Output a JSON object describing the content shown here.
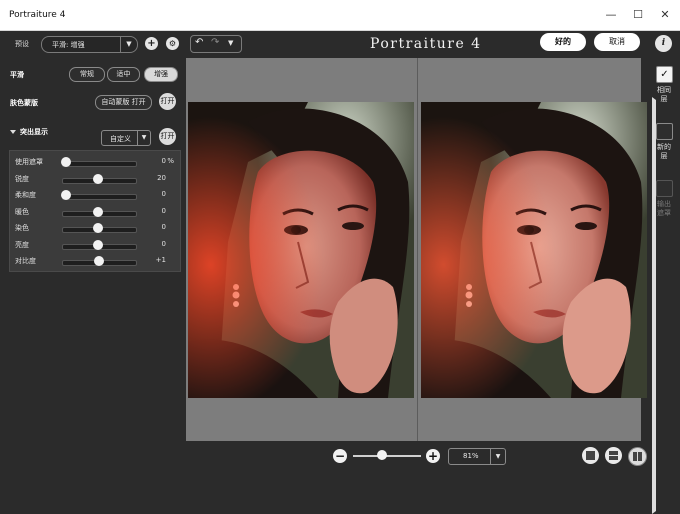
{
  "window": {
    "title": "Portraiture 4",
    "minimize": "—",
    "maximize": "☐",
    "close": "✕"
  },
  "topbar": {
    "preset_label": "预设",
    "preset_value": "平滑: 增强",
    "brand": "Portraiture 4",
    "ok_label": "好的",
    "cancel_label": "取消",
    "help": "i"
  },
  "panel": {
    "smoothing": {
      "title": "平滑",
      "options": [
        "常规",
        "适中",
        "增强"
      ],
      "active": 2
    },
    "skin_mask": {
      "title": "肤色蒙版",
      "auto_label": "自动蒙版 打开",
      "toggle": "打开"
    },
    "enhance": {
      "title": "突出显示",
      "mode": "自定义",
      "toggle": "打开"
    },
    "sliders": [
      {
        "name": "使用遮罩",
        "value": "0",
        "unit": "%",
        "level": 0.0
      },
      {
        "name": "锐度",
        "value": "20",
        "unit": "",
        "level": 0.5
      },
      {
        "name": "柔和度",
        "value": "0",
        "unit": "",
        "level": 0.0
      },
      {
        "name": "暖色",
        "value": "0",
        "unit": "",
        "level": 0.5
      },
      {
        "name": "染色",
        "value": "0",
        "unit": "",
        "level": 0.5
      },
      {
        "name": "亮度",
        "value": "0",
        "unit": "",
        "level": 0.5
      },
      {
        "name": "对比度",
        "value": "+1",
        "unit": "",
        "level": 0.52
      }
    ]
  },
  "output": {
    "same_layer": "相同层",
    "new_layer": "新的层",
    "output_mask": "输出遮罩"
  },
  "zoom": {
    "value": "81%",
    "level": 0.4
  },
  "colors": {
    "bg": "#2b2b2b",
    "canvas": "#7d7d7d",
    "accent": "#ffffff"
  }
}
